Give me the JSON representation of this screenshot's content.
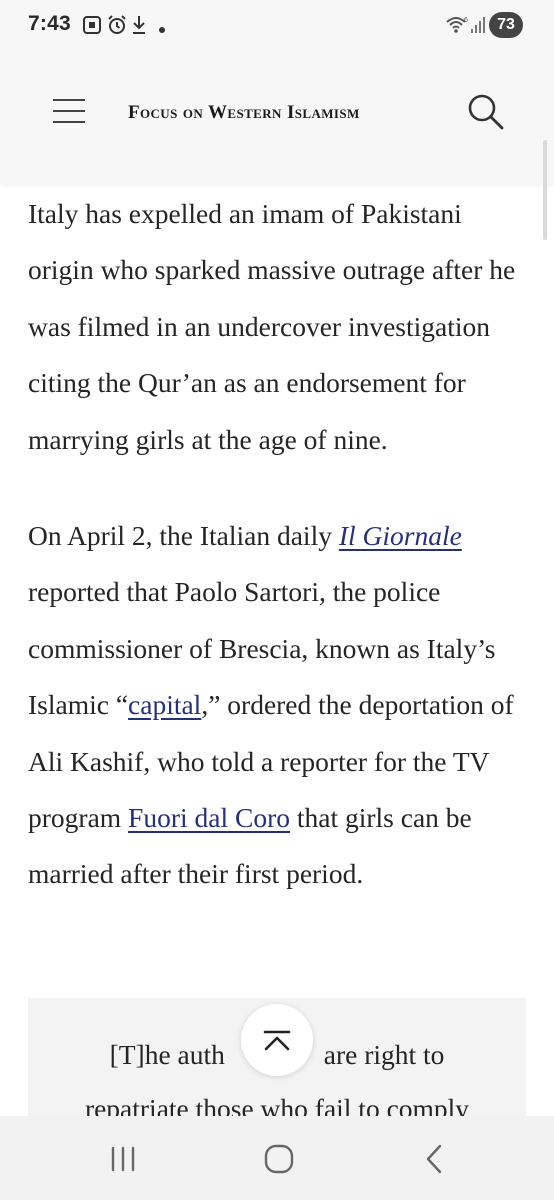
{
  "status_bar": {
    "time": "7:43",
    "battery": "73",
    "icons": [
      "screenshot-icon",
      "alarm-icon",
      "download-icon",
      "notification-dot-icon",
      "wifi-icon",
      "signal-icon"
    ]
  },
  "header": {
    "title": "Focus on Western Islamism",
    "menu_icon": "hamburger-menu-icon",
    "search_icon": "search-icon"
  },
  "article": {
    "p1": "Italy has expelled an imam of Pakistani origin who sparked massive outrage after he was filmed in an undercover investigation citing the Qur’an as an endorsement for marrying girls at the age of nine.",
    "p2": {
      "t1": "On April 2, the Italian daily ",
      "link1": "Il Giornale",
      "t2": " reported that Paolo Sartori, the police commissioner of Brescia, known as Italy’s Islamic “",
      "link2": "capital",
      "t3": ",” ordered the deportation of Ali Kashif, who told a reporter for the TV program ",
      "link3": "Fuori dal Coro",
      "t4": " that girls can be married after their first period."
    },
    "quote": {
      "line1_start": "[T]he auth",
      "line1_end": " are right to",
      "line2": "repatriate those who fail to comply"
    }
  },
  "scroll_top_icon": "chevron-up-bar-icon",
  "nav_bar": {
    "icons": [
      "recent-apps-icon",
      "home-icon",
      "back-icon"
    ]
  },
  "colors": {
    "link": "#24307a",
    "chrome": "#f7f7f7",
    "quote_bg": "#f3f3f3"
  }
}
